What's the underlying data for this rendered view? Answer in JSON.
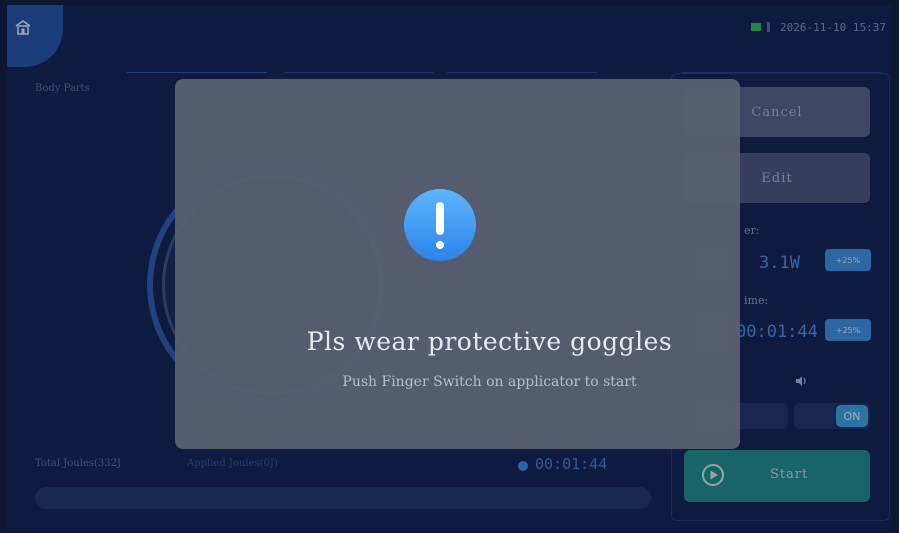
{
  "status": {
    "datetime": "2026-11-10 15:37",
    "battery_color": "#26c24a"
  },
  "home": {
    "icon": "home-icon"
  },
  "left": {
    "body_parts_label": "Body Parts",
    "total_joules": "Total Joules(332J",
    "applied_joules": "Applied Joules(0J)",
    "timer": "00:01:44"
  },
  "right": {
    "cancel_label": "Cancel",
    "edit_label": "Edit",
    "power_label": "er:",
    "power_value": "3.1W",
    "power_step": "+25%",
    "time_label": "ime:",
    "time_value": "00:01:44",
    "time_step": "+25%",
    "volume_icon": "speaker-icon",
    "toggle_on_label": "ON",
    "start_label": "Start",
    "start_icon": "play-icon"
  },
  "modal": {
    "icon": "warning-icon",
    "title": "Pls wear protective goggles",
    "subtitle": "Push Finger Switch on applicator to start"
  }
}
